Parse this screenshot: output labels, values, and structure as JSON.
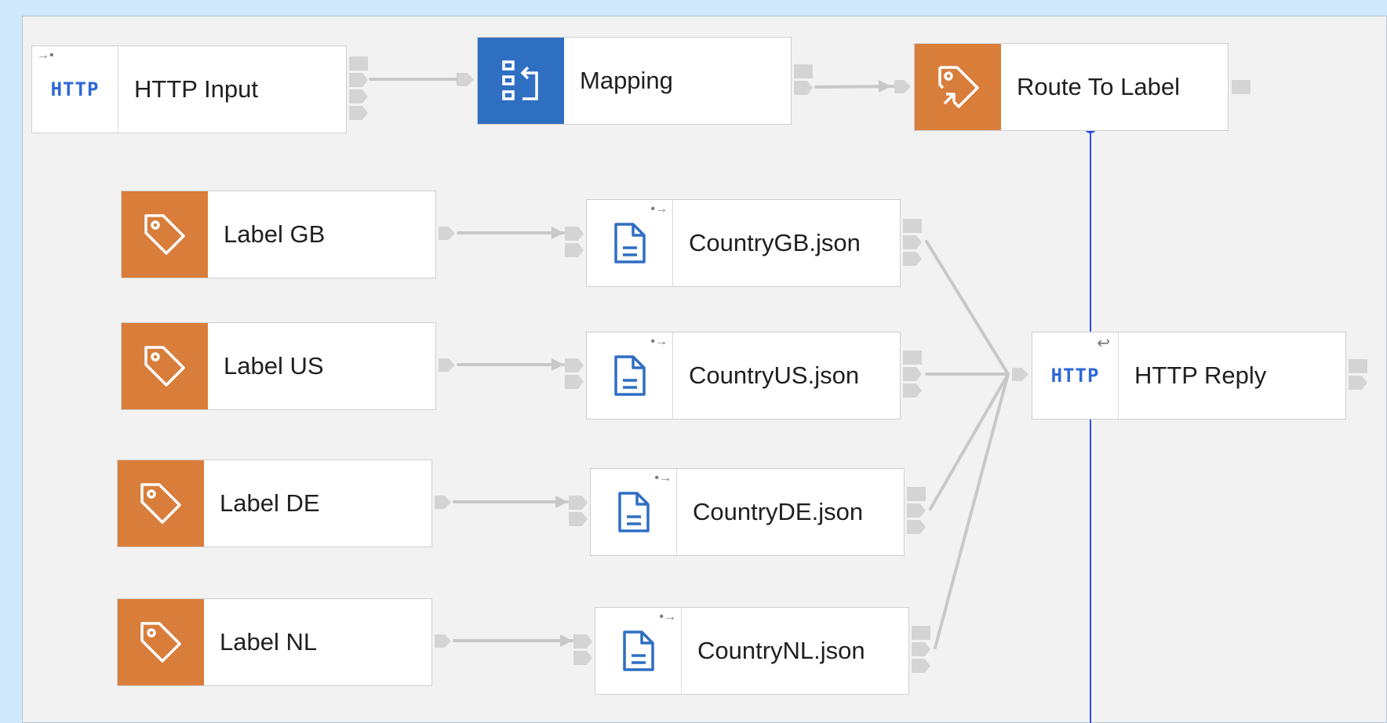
{
  "nodes": {
    "http_input": {
      "label": "HTTP Input",
      "icon_text": "HTTP",
      "icon": "http-input-icon"
    },
    "mapping": {
      "label": "Mapping",
      "icon": "mapping-icon"
    },
    "route_to_label": {
      "label": "Route To Label",
      "icon": "route-to-label-icon"
    },
    "label_gb": {
      "label": "Label GB",
      "icon": "tag-icon"
    },
    "label_us": {
      "label": "Label US",
      "icon": "tag-icon"
    },
    "label_de": {
      "label": "Label DE",
      "icon": "tag-icon"
    },
    "label_nl": {
      "label": "Label NL",
      "icon": "tag-icon"
    },
    "country_gb": {
      "label": "CountryGB.json",
      "icon": "document-icon"
    },
    "country_us": {
      "label": "CountryUS.json",
      "icon": "document-icon"
    },
    "country_de": {
      "label": "CountryDE.json",
      "icon": "document-icon"
    },
    "country_nl": {
      "label": "CountryNL.json",
      "icon": "document-icon"
    },
    "http_reply": {
      "label": "HTTP Reply",
      "icon_text": "HTTP",
      "icon": "http-reply-icon"
    }
  },
  "colors": {
    "canvas_background": "#f2f2f2",
    "outer_background": "#cfe8fb",
    "orange_node": "#d97d3b",
    "blue_node": "#2f6fc2",
    "http_text": "#2f67d8",
    "document_icon": "#2f6fc2",
    "connection": "#c8c8c8",
    "selection_line": "#2a4fe0"
  }
}
